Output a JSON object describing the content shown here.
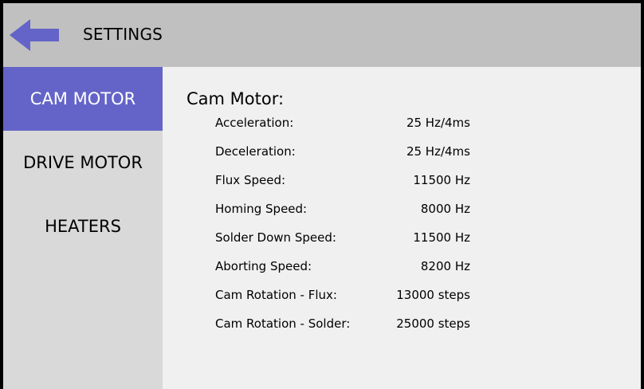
{
  "header": {
    "title": "SETTINGS",
    "back_icon": "left-arrow-icon",
    "accent_color": "#6464c8"
  },
  "sidebar": {
    "items": [
      {
        "label": "CAM MOTOR",
        "active": true
      },
      {
        "label": "DRIVE MOTOR",
        "active": false
      },
      {
        "label": "HEATERS",
        "active": false
      }
    ]
  },
  "content": {
    "title": "Cam Motor:",
    "rows": [
      {
        "label": "Acceleration:",
        "value": "25 Hz/4ms"
      },
      {
        "label": "Deceleration:",
        "value": "25 Hz/4ms"
      },
      {
        "label": "Flux Speed:",
        "value": "11500 Hz"
      },
      {
        "label": "Homing Speed:",
        "value": "8000 Hz"
      },
      {
        "label": "Solder Down Speed:",
        "value": "11500 Hz"
      },
      {
        "label": "Aborting Speed:",
        "value": "8200 Hz"
      },
      {
        "label": "Cam Rotation - Flux:",
        "value": "13000 steps"
      },
      {
        "label": "Cam Rotation - Solder:",
        "value": "25000 steps"
      }
    ]
  }
}
